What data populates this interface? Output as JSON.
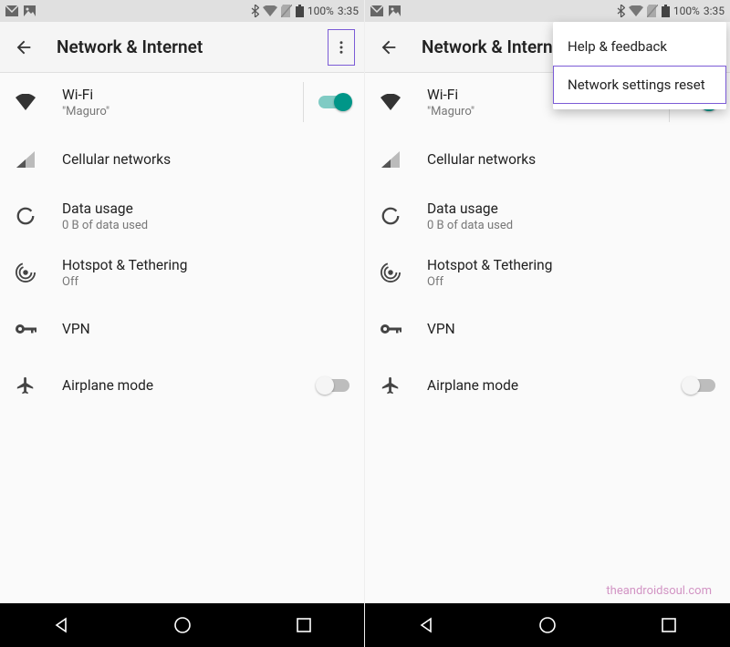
{
  "status": {
    "battery_pct": "100%",
    "time": "3:35"
  },
  "header": {
    "title": "Network & Internet"
  },
  "rows": {
    "wifi": {
      "title": "Wi-Fi",
      "sub": "\"Maguro\""
    },
    "cell": {
      "title": "Cellular networks"
    },
    "data": {
      "title": "Data usage",
      "sub": "0 B of data used"
    },
    "hotspot": {
      "title": "Hotspot & Tethering",
      "sub": "Off"
    },
    "vpn": {
      "title": "VPN"
    },
    "airplane": {
      "title": "Airplane mode"
    }
  },
  "menu": {
    "help": "Help & feedback",
    "reset": "Network settings reset"
  },
  "watermark": "theandroidsoul.com"
}
